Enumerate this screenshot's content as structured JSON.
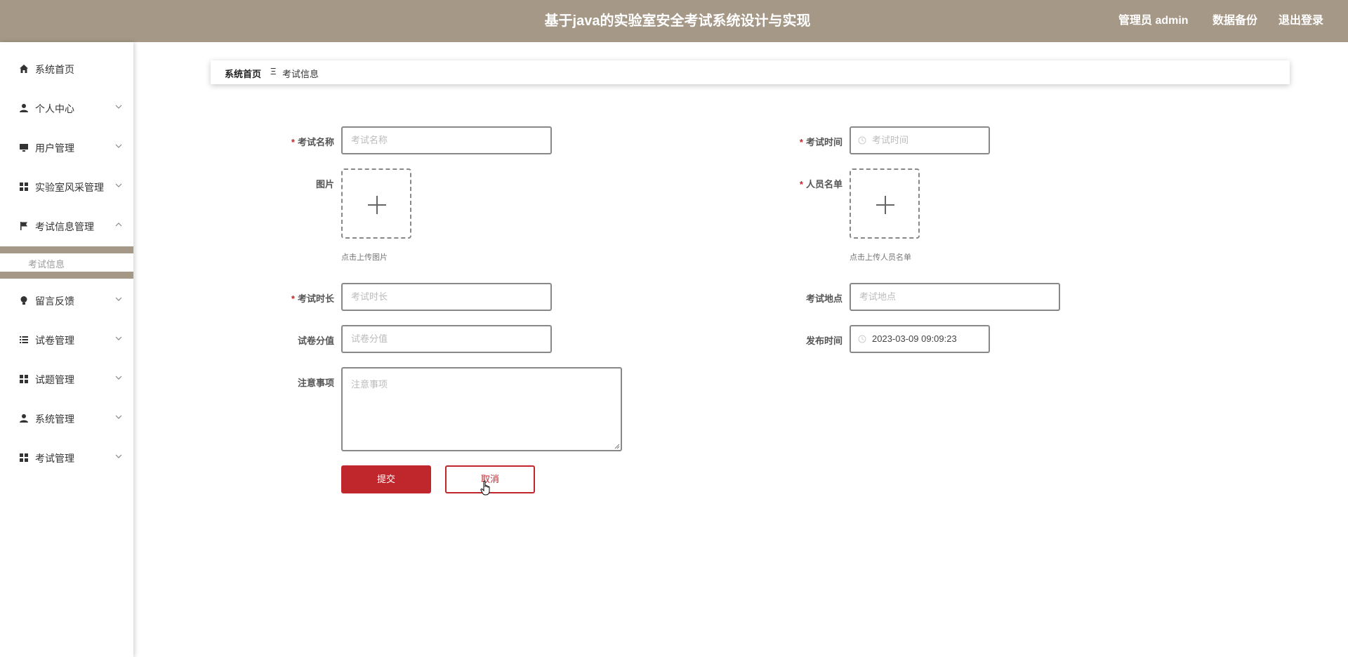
{
  "header": {
    "title": "基于java的实验室安全考试系统设计与实现",
    "user_label": "管理员 admin",
    "backup_label": "数据备份",
    "logout_label": "退出登录"
  },
  "sidebar": {
    "items": [
      {
        "label": "系统首页",
        "icon": "home-icon"
      },
      {
        "label": "个人中心",
        "icon": "user-icon"
      },
      {
        "label": "用户管理",
        "icon": "monitor-icon"
      },
      {
        "label": "实验室风采管理",
        "icon": "grid-icon"
      },
      {
        "label": "考试信息管理",
        "icon": "flag-icon"
      },
      {
        "label": "留言反馈",
        "icon": "bulb-icon"
      },
      {
        "label": "试卷管理",
        "icon": "list-icon"
      },
      {
        "label": "试题管理",
        "icon": "grid-icon"
      },
      {
        "label": "系统管理",
        "icon": "user-icon"
      },
      {
        "label": "考试管理",
        "icon": "grid-icon"
      }
    ],
    "submenu": {
      "label": "考试信息"
    }
  },
  "breadcrumb": {
    "home": "系统首页",
    "separator": "Ξ",
    "current": "考试信息"
  },
  "form": {
    "exam_name": {
      "label": "考试名称",
      "placeholder": "考试名称",
      "required": true
    },
    "exam_time": {
      "label": "考试时间",
      "placeholder": "考试时间",
      "required": true
    },
    "picture": {
      "label": "图片",
      "hint": "点击上传图片"
    },
    "roster": {
      "label": "人员名单",
      "hint": "点击上传人员名单",
      "required": true
    },
    "duration": {
      "label": "考试时长",
      "placeholder": "考试时长",
      "required": true
    },
    "location": {
      "label": "考试地点",
      "placeholder": "考试地点"
    },
    "score": {
      "label": "试卷分值",
      "placeholder": "试卷分值"
    },
    "publish_time": {
      "label": "发布时间",
      "value": "2023-03-09 09:09:23"
    },
    "notes": {
      "label": "注意事项",
      "placeholder": "注意事项"
    },
    "submit_label": "提交",
    "cancel_label": "取消",
    "required_mark": "*"
  },
  "colors": {
    "header_bg": "#a59886",
    "accent": "#c0272d"
  }
}
